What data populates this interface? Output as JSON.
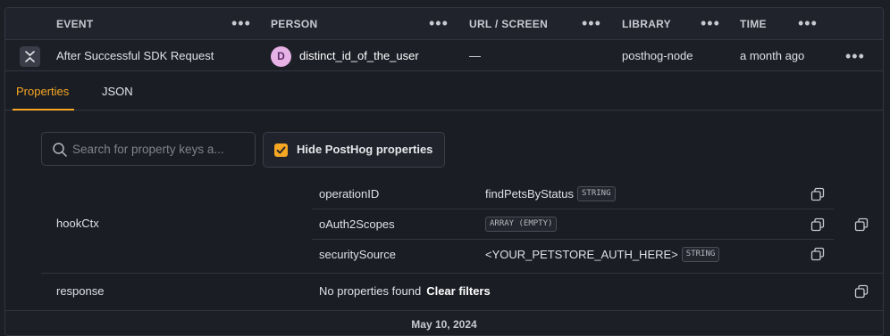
{
  "table": {
    "columns": [
      "EVENT",
      "PERSON",
      "URL / SCREEN",
      "LIBRARY",
      "TIME"
    ],
    "row": {
      "event": "After Successful SDK Request",
      "person_initial": "D",
      "person": "distinct_id_of_the_user",
      "url": "—",
      "library": "posthog-node",
      "time": "a month ago"
    }
  },
  "tabs": [
    {
      "label": "Properties",
      "active": true
    },
    {
      "label": "JSON",
      "active": false
    }
  ],
  "filters": {
    "search_placeholder": "Search for property keys a...",
    "search_value": "",
    "hide_posthog_label": "Hide PostHog properties",
    "hide_posthog_checked": true
  },
  "properties": {
    "hookCtx": {
      "key": "hookCtx",
      "entries": [
        {
          "key": "operationID",
          "value": "findPetsByStatus",
          "type": "STRING"
        },
        {
          "key": "oAuth2Scopes",
          "value": "",
          "type": "ARRAY (EMPTY)"
        },
        {
          "key": "securitySource",
          "value": "<YOUR_PETSTORE_AUTH_HERE>",
          "type": "STRING"
        }
      ]
    },
    "response": {
      "key": "response",
      "empty_text": "No properties found",
      "clear_label": "Clear filters"
    }
  },
  "date_separator": "May 10, 2024",
  "colors": {
    "background": "#1d1f27",
    "accent": "#f5a623",
    "avatar": "#e7b2e6",
    "border": "#33353f"
  },
  "icons": [
    "chevron-collapse-icon",
    "more-dots-icon",
    "search-icon",
    "check-icon",
    "copy-icon"
  ]
}
